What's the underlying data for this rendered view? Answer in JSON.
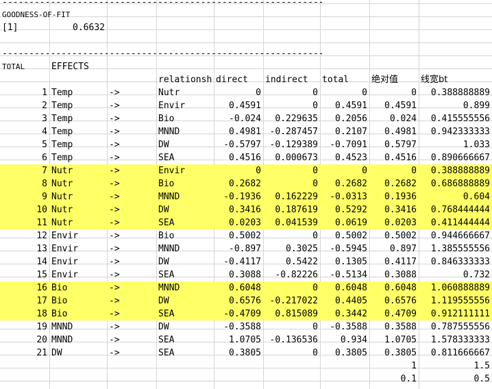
{
  "sheet": {
    "dash_line": "----------------------------------------------------------------",
    "gof_label": "GOODNESS-OF-FIT",
    "gof_index": "[1]",
    "gof_value": "0.6632",
    "total_label": "TOTAL",
    "effects_label": "EFFECTS",
    "headers": [
      "relationsh",
      "direct",
      "indirect",
      "total",
      "绝对值",
      "线宽bt"
    ],
    "rows": [
      {
        "n": "1",
        "from": "Temp",
        "arrow": "->",
        "to": "Nutr",
        "direct": "0",
        "indirect": "0",
        "total": "0",
        "abs": "0",
        "bt": "0.388888889",
        "hl": false
      },
      {
        "n": "2",
        "from": "Temp",
        "arrow": "->",
        "to": "Envir",
        "direct": "0.4591",
        "indirect": "0",
        "total": "0.4591",
        "abs": "0.4591",
        "bt": "0.899",
        "hl": false
      },
      {
        "n": "3",
        "from": "Temp",
        "arrow": "->",
        "to": "Bio",
        "direct": "-0.024",
        "indirect": "0.229635",
        "total": "0.2056",
        "abs": "0.024",
        "bt": "0.415555556",
        "hl": false
      },
      {
        "n": "4",
        "from": "Temp",
        "arrow": "->",
        "to": "MNND",
        "direct": "0.4981",
        "indirect": "-0.287457",
        "total": "0.2107",
        "abs": "0.4981",
        "bt": "0.942333333",
        "hl": false
      },
      {
        "n": "5",
        "from": "Temp",
        "arrow": "->",
        "to": "DW",
        "direct": "-0.5797",
        "indirect": "-0.129389",
        "total": "-0.7091",
        "abs": "0.5797",
        "bt": "1.033",
        "hl": false
      },
      {
        "n": "6",
        "from": "Temp",
        "arrow": "->",
        "to": "SEA",
        "direct": "0.4516",
        "indirect": "0.000673",
        "total": "0.4523",
        "abs": "0.4516",
        "bt": "0.890666667",
        "hl": false
      },
      {
        "n": "7",
        "from": "Nutr",
        "arrow": "->",
        "to": "Envir",
        "direct": "0",
        "indirect": "0",
        "total": "0",
        "abs": "0",
        "bt": "0.388888889",
        "hl": true
      },
      {
        "n": "8",
        "from": "Nutr",
        "arrow": "->",
        "to": "Bio",
        "direct": "0.2682",
        "indirect": "0",
        "total": "0.2682",
        "abs": "0.2682",
        "bt": "0.686888889",
        "hl": true
      },
      {
        "n": "9",
        "from": "Nutr",
        "arrow": "->",
        "to": "MNND",
        "direct": "-0.1936",
        "indirect": "0.162229",
        "total": "-0.0313",
        "abs": "0.1936",
        "bt": "0.604",
        "hl": true
      },
      {
        "n": "10",
        "from": "Nutr",
        "arrow": "->",
        "to": "DW",
        "direct": "0.3416",
        "indirect": "0.187619",
        "total": "0.5292",
        "abs": "0.3416",
        "bt": "0.768444444",
        "hl": true
      },
      {
        "n": "11",
        "from": "Nutr",
        "arrow": "->",
        "to": "SEA",
        "direct": "0.0203",
        "indirect": "0.041539",
        "total": "0.0619",
        "abs": "0.0203",
        "bt": "0.411444444",
        "hl": true
      },
      {
        "n": "12",
        "from": "Envir",
        "arrow": "->",
        "to": "Bio",
        "direct": "0.5002",
        "indirect": "0",
        "total": "0.5002",
        "abs": "0.5002",
        "bt": "0.944666667",
        "hl": false
      },
      {
        "n": "13",
        "from": "Envir",
        "arrow": "->",
        "to": "MNND",
        "direct": "-0.897",
        "indirect": "0.3025",
        "total": "-0.5945",
        "abs": "0.897",
        "bt": "1.385555556",
        "hl": false
      },
      {
        "n": "14",
        "from": "Envir",
        "arrow": "->",
        "to": "DW",
        "direct": "-0.4117",
        "indirect": "0.5422",
        "total": "0.1305",
        "abs": "0.4117",
        "bt": "0.846333333",
        "hl": false
      },
      {
        "n": "15",
        "from": "Envir",
        "arrow": "->",
        "to": "SEA",
        "direct": "0.3088",
        "indirect": "-0.82226",
        "total": "-0.5134",
        "abs": "0.3088",
        "bt": "0.732",
        "hl": false
      },
      {
        "n": "16",
        "from": "Bio",
        "arrow": "->",
        "to": "MNND",
        "direct": "0.6048",
        "indirect": "0",
        "total": "0.6048",
        "abs": "0.6048",
        "bt": "1.060888889",
        "hl": true
      },
      {
        "n": "17",
        "from": "Bio",
        "arrow": "->",
        "to": "DW",
        "direct": "0.6576",
        "indirect": "-0.217022",
        "total": "0.4405",
        "abs": "0.6576",
        "bt": "1.119555556",
        "hl": true
      },
      {
        "n": "18",
        "from": "Bio",
        "arrow": "->",
        "to": "SEA",
        "direct": "-0.4709",
        "indirect": "0.815089",
        "total": "0.3442",
        "abs": "0.4709",
        "bt": "0.912111111",
        "hl": true
      },
      {
        "n": "19",
        "from": "MNND",
        "arrow": "->",
        "to": "DW",
        "direct": "-0.3588",
        "indirect": "0",
        "total": "-0.3588",
        "abs": "0.3588",
        "bt": "0.787555556",
        "hl": false
      },
      {
        "n": "20",
        "from": "MNND",
        "arrow": "->",
        "to": "SEA",
        "direct": "1.0705",
        "indirect": "-0.136536",
        "total": "0.934",
        "abs": "1.0705",
        "bt": "1.578333333",
        "hl": false
      },
      {
        "n": "21",
        "from": "DW",
        "arrow": "->",
        "to": "SEA",
        "direct": "0.3805",
        "indirect": "0",
        "total": "0.3805",
        "abs": "0.3805",
        "bt": "0.811666667",
        "hl": false
      }
    ],
    "footer": [
      {
        "abs": "1",
        "bt": "1.5"
      },
      {
        "abs": "0.1",
        "bt": "0.5"
      }
    ],
    "highlight_color": "#ffff66"
  }
}
